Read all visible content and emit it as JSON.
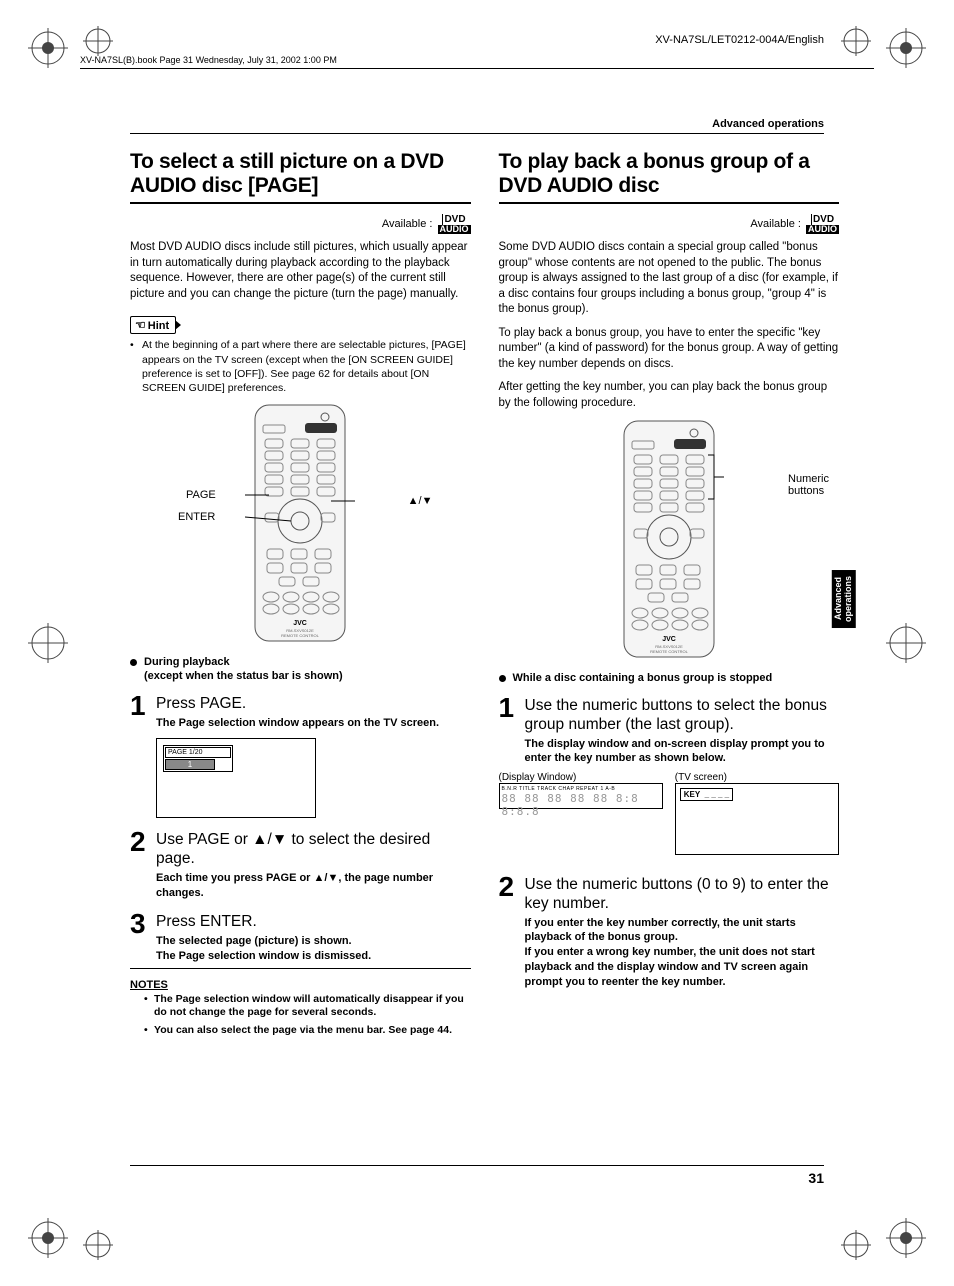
{
  "meta": {
    "book_header": "XV-NA7SL(B).book  Page 31  Wednesday, July 31, 2002  1:00 PM",
    "doc_code": "XV-NA7SL/LET0212-004A/English",
    "section": "Advanced operations",
    "page_number": "31",
    "side_tab_line1": "Advanced",
    "side_tab_line2": "operations"
  },
  "left": {
    "title": "To select a still picture on a DVD AUDIO disc [PAGE]",
    "available_label": "Available :",
    "badge_top": "DVD",
    "badge_bottom": "AUDIO",
    "intro": "Most DVD AUDIO discs include still pictures, which usually appear in turn automatically during playback according to the playback sequence. However, there are other page(s) of the current still picture and you can change the picture (turn the page) manually.",
    "hint_label": "Hint",
    "hint_bullet": "At the beginning of a part where there are selectable pictures, [PAGE] appears on the TV screen (except when the [ON SCREEN GUIDE] preference is set to [OFF]). See page 62 for details about [ON SCREEN GUIDE] preferences.",
    "remote_labels": {
      "page": "PAGE",
      "enter": "ENTER",
      "arrows": "▲/▼"
    },
    "status1": "During playback",
    "status1_sub": "(except when the status bar is shown)",
    "steps": [
      {
        "num": "1",
        "title": "Press PAGE.",
        "desc": "The Page selection window appears on the TV screen."
      },
      {
        "num": "2",
        "title": "Use PAGE or ▲/▼ to select the desired page.",
        "desc": "Each time you press PAGE or ▲/▼, the page number changes."
      },
      {
        "num": "3",
        "title": "Press ENTER.",
        "desc": "The selected page (picture) is shown.\nThe Page selection window is dismissed."
      }
    ],
    "page_window_label": "PAGE 1/20",
    "page_window_value": "1",
    "notes_header": "NOTES",
    "notes": [
      "The Page selection window will automatically disappear if you do not change the page for several seconds.",
      "You can also select the page via the menu bar. See page 44."
    ]
  },
  "right": {
    "title": "To play back a bonus group of a DVD AUDIO disc",
    "available_label": "Available :",
    "badge_top": "DVD",
    "badge_bottom": "AUDIO",
    "para1": "Some DVD AUDIO discs contain a special group called \"bonus group\" whose contents are not opened to the public. The bonus group is always assigned to the last group of a disc (for example, if a disc contains four groups including a bonus group, \"group 4\" is the bonus group).",
    "para2": "To play back a bonus group, you have to enter the specific \"key number\" (a kind of password) for the bonus group. A way of getting the key number depends on discs.",
    "para3": "After getting the key number, you can play back the bonus group by the following procedure.",
    "remote_label_numeric_l1": "Numeric",
    "remote_label_numeric_l2": "buttons",
    "status1": "While a disc containing a bonus group is stopped",
    "steps": [
      {
        "num": "1",
        "title": "Use the numeric buttons to select the bonus group number (the last group).",
        "desc": "The display window and on-screen display prompt you to enter the key number as shown below."
      },
      {
        "num": "2",
        "title": "Use the numeric buttons (0 to 9) to enter the key number.",
        "desc": "If you enter the key number correctly, the unit starts playback of the bonus group.\nIf you enter a wrong key number, the unit does not start playback and the display window and TV screen again prompt you to reenter the key number."
      }
    ],
    "display_window_label": "(Display Window)",
    "tv_screen_label": "(TV screen)",
    "lcd_top": "B.N.R  TITLE         TRACK CHAP  REPEAT 1 A-B",
    "lcd_seg": "88 88 88 88 88 8:8 8:8.8",
    "tv_key_label": "KEY",
    "tv_key_value": "_ _ _ _"
  }
}
